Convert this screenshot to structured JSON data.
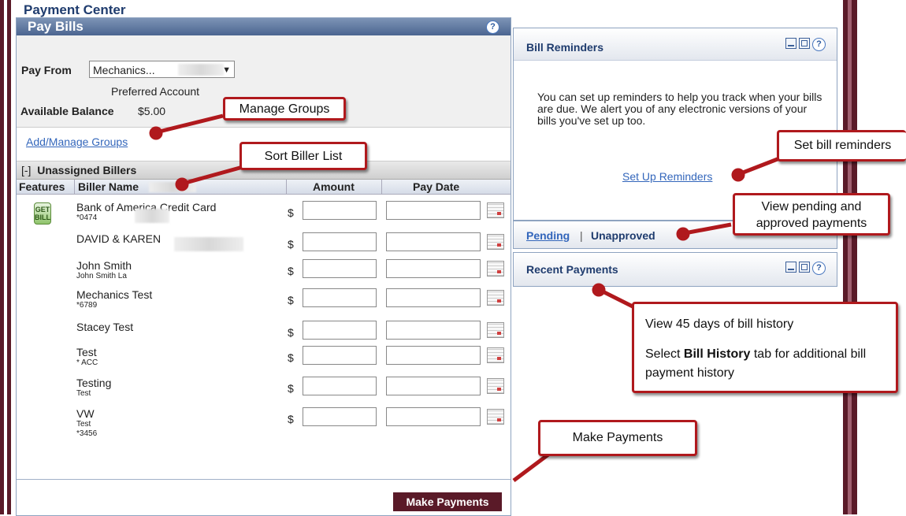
{
  "page_title": "Payment Center",
  "pay_bills": {
    "title": "Pay Bills",
    "help": "?",
    "pay_from_label": "Pay From",
    "pay_from_value": "Mechanics...",
    "preferred": "Preferred Account",
    "available_label": "Available Balance",
    "available_value": "$5.00",
    "groups_link": "Add/Manage Groups",
    "unassigned_toggle": "[-]",
    "unassigned_label": "Unassigned Billers",
    "columns": {
      "features": "Features",
      "biller": "Biller Name",
      "amount": "Amount",
      "pay_date": "Pay Date"
    },
    "currency": "$",
    "get_bill_icon": "GET BILL",
    "billers": [
      {
        "name": "Bank of America Credit Card",
        "sub": "*0474",
        "sub2": ""
      },
      {
        "name": "DAVID & KAREN",
        "sub": "",
        "sub2": ""
      },
      {
        "name": "John Smith",
        "sub": "John Smith La",
        "sub2": ""
      },
      {
        "name": "Mechanics Test",
        "sub": "*6789",
        "sub2": ""
      },
      {
        "name": "Stacey Test",
        "sub": "",
        "sub2": ""
      },
      {
        "name": "Test",
        "sub": "* ACC",
        "sub2": ""
      },
      {
        "name": "Testing",
        "sub": "Test",
        "sub2": ""
      },
      {
        "name": "VW",
        "sub": "Test",
        "sub2": "*3456"
      }
    ],
    "make_payments": "Make Payments"
  },
  "bill_reminders": {
    "title": "Bill Reminders",
    "body": "You can set up reminders to help you track when your bills are due. We alert you of any electronic versions of your bills you've set up too.",
    "link": "Set Up Reminders"
  },
  "pending": {
    "pending": "Pending",
    "sep": "|",
    "unapproved": "Unapproved"
  },
  "recent": {
    "title": "Recent Payments"
  },
  "callouts": {
    "manage_groups": "Manage Groups",
    "sort": "Sort Biller List",
    "reminders": "Set bill reminders",
    "pending": "View pending and approved payments",
    "history_1": "View 45 days of bill history",
    "history_2a": "Select",
    "history_2b": "Bill History",
    "history_2c": "tab for additional bill payment history",
    "make": "Make Payments"
  },
  "colors": {
    "accent": "#1f3c6e",
    "callout_border": "#b0191d",
    "button": "#5a1a28"
  }
}
